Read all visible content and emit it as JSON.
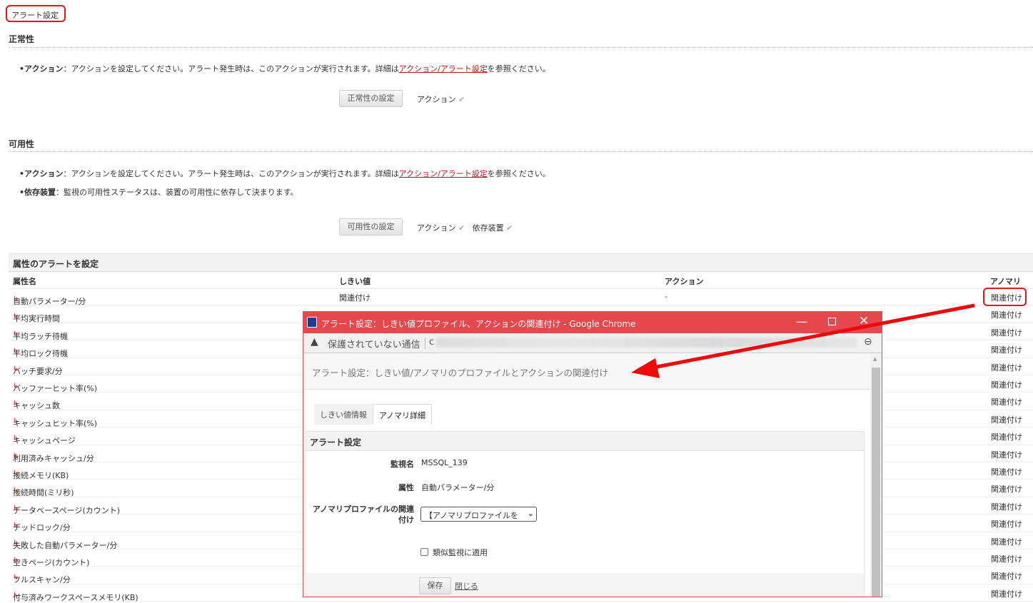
{
  "breadcrumb": "アラート設定",
  "health": {
    "title": "正常性",
    "bullet_label": "•アクション",
    "bullet_text": "：アクションを設定してください。アラート発生時は、このアクションが実行されます。詳細は",
    "link": "アクション/アラート設定",
    "bullet_tail": "を参照ください。",
    "button": "正常性の設定",
    "status": "アクション",
    "check": "✔"
  },
  "availability": {
    "title": "可用性",
    "bullet1_label": "•アクション",
    "bullet1_text": "：アクションを設定してください。アラート発生時は、このアクションが実行されます。詳細は",
    "link": "アクション/アラート設定",
    "bullet1_tail": "を参照ください。",
    "bullet2_label": "•依存装置",
    "bullet2_text": "：監視の可用性ステータスは、装置の可用性に依存して決まります。",
    "button": "可用性の設定",
    "status1": "アクション",
    "status2": "依存装置",
    "check": "✔"
  },
  "attr_table": {
    "title": "属性のアラートを設定",
    "columns": [
      "属性名",
      "しきい値",
      "アクション",
      "アノマリ"
    ],
    "rows": [
      {
        "name": "自動パラメーター/分",
        "threshold": "関連付け",
        "action": "-",
        "anomaly": "関連付け"
      },
      {
        "name": "平均実行時間",
        "anomaly": "関連付け"
      },
      {
        "name": "平均ラッチ待機",
        "anomaly": "関連付け"
      },
      {
        "name": "平均ロック待機",
        "anomaly": "関連付け"
      },
      {
        "name": "バッチ要求/分",
        "anomaly": "関連付け"
      },
      {
        "name": "バッファーヒット率(%)",
        "anomaly": "関連付け"
      },
      {
        "name": "キャッシュ数",
        "anomaly": "関連付け"
      },
      {
        "name": "キャッシュヒット率(%)",
        "anomaly": "関連付け"
      },
      {
        "name": "キャッシュページ",
        "anomaly": "関連付け"
      },
      {
        "name": "利用済みキャッシュ/分",
        "anomaly": "関連付け"
      },
      {
        "name": "接続メモリ(KB)",
        "anomaly": "関連付け"
      },
      {
        "name": "接続時間(ミリ秒)",
        "anomaly": "関連付け"
      },
      {
        "name": "データベースページ(カウント)",
        "anomaly": "関連付け"
      },
      {
        "name": "デッドロック/分",
        "anomaly": "関連付け"
      },
      {
        "name": "失敗した自動パラメーター/分",
        "anomaly": "関連付け"
      },
      {
        "name": "空きページ(カウント)",
        "anomaly": "関連付け"
      },
      {
        "name": "フルスキャン/分",
        "anomaly": "関連付け"
      },
      {
        "name": "付与済みワークスペースメモリ(KB)",
        "anomaly": "関連付け"
      }
    ]
  },
  "popup": {
    "window_title": "アラート設定：しきい値プロファイル、アクションの関連付け - Google Chrome",
    "security_text": "保護されていない通信",
    "url_prefix": "c",
    "page_title": "アラート設定：しきい値/アノマリのプロファイルとアクションの関連付け",
    "tabs": [
      "しきい値情報",
      "アノマリ詳細"
    ],
    "active_tab": "アノマリ詳細",
    "section_title": "アラート設定",
    "monitor_label": "監視名",
    "monitor_value": "MSSQL_139",
    "attr_label": "属性",
    "attr_value": "自動パラメーター/分",
    "profile_label": "アノマリプロファイルの関連付け",
    "profile_select": "【アノマリプロファイルを",
    "apply_similar": "類似監視に適用",
    "save": "保存",
    "close": "閉じる"
  },
  "colors": {
    "highlight": "#e8141c",
    "titlebar": "#e5484d",
    "link": "#b01c1c"
  }
}
